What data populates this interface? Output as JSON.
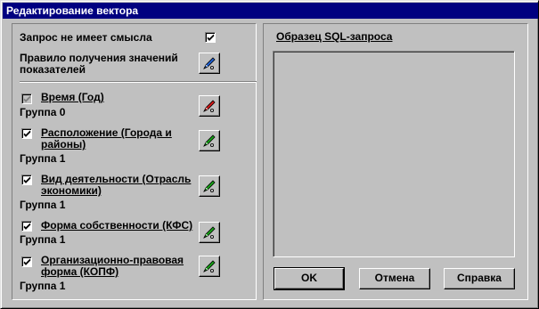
{
  "window": {
    "title": "Редактирование вектора"
  },
  "left": {
    "meaningless": {
      "label": "Запрос не имеет смысла",
      "checked": true
    },
    "rule": {
      "label_line1": "Правило получения значений",
      "label_line2": "показателей",
      "icon": "pen-icon",
      "icon_color": "#1f5fd0"
    },
    "dimensions": [
      {
        "name_line1": "Время (Год)",
        "name_line2": "",
        "group": "Группа 0",
        "checked": true,
        "disabled": true,
        "icon": "pen-icon",
        "icon_color": "#d01818"
      },
      {
        "name_line1": "Расположение (Города и",
        "name_line2": "районы)",
        "group": "Группа 1",
        "checked": true,
        "disabled": false,
        "icon": "pen-icon",
        "icon_color": "#18a018"
      },
      {
        "name_line1": "Вид деятельности (Отрасль",
        "name_line2": "экономики)",
        "group": "Группа 1",
        "checked": true,
        "disabled": false,
        "icon": "pen-icon",
        "icon_color": "#18a018"
      },
      {
        "name_line1": "Форма собственности (КФС)",
        "name_line2": "",
        "group": "Группа 1",
        "checked": true,
        "disabled": false,
        "icon": "pen-icon",
        "icon_color": "#18a018"
      },
      {
        "name_line1": "Организационно-правовая",
        "name_line2": "форма (КОПФ)",
        "group": "Группа 1",
        "checked": true,
        "disabled": false,
        "icon": "pen-icon",
        "icon_color": "#18a018"
      }
    ]
  },
  "right": {
    "sql_label": "Образец SQL-запроса",
    "sql_text": "",
    "buttons": {
      "ok": "OK",
      "cancel": "Отмена",
      "help": "Справка"
    }
  }
}
